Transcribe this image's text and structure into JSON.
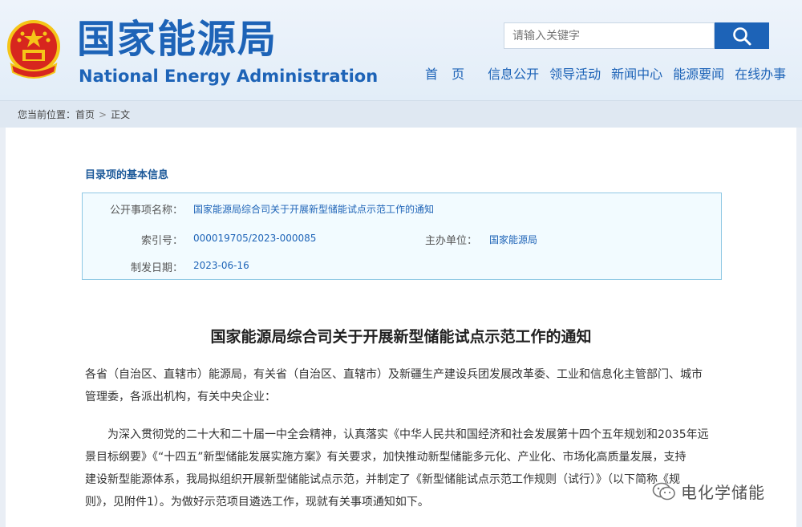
{
  "header": {
    "logo_cn": "国家能源局",
    "logo_en": "National Energy Administration",
    "search_placeholder": "请输入关键字",
    "nav": [
      "首 页",
      "信息公开",
      "领导活动",
      "新闻中心",
      "能源要闻",
      "在线办事"
    ]
  },
  "breadcrumb": {
    "label": "您当前位置：",
    "items": [
      "首页",
      "正文"
    ]
  },
  "info": {
    "section_title": "目录项的基本信息",
    "name_label": "公开事项名称：",
    "name_value": "国家能源局综合司关于开展新型储能试点示范工作的通知",
    "index_label": "索引号：",
    "index_value": "000019705/2023-000085",
    "org_label": "主办单位：",
    "org_value": "国家能源局",
    "date_label": "制发日期：",
    "date_value": "2023-06-16"
  },
  "article": {
    "title": "国家能源局综合司关于开展新型储能试点示范工作的通知",
    "para1_line1": "各省（自治区、直辖市）能源局，有关省（自治区、直辖市）及新疆生产建设兵团发展改革委、工业和信息化主管部门、城市",
    "para1_line2": "管理委，各派出机构，有关中央企业：",
    "para2_line1": "为深入贯彻党的二十大和二十届一中全会精神，认真落实《中华人民共和国经济和社会发展第十四个五年规划和2035年远",
    "para2_line2": "景目标纲要》《“十四五”新型储能发展实施方案》有关要求，加快推动新型储能多元化、产业化、市场化高质量发展，支持",
    "para2_line3": "建设新型能源体系，我局拟组织开展新型储能试点示范，并制定了《新型储能试点示范工作规则（试行）》（以下简称《规",
    "para2_line4": "则》，见附件1）。为做好示范项目遴选工作，现就有关事项通知如下。"
  },
  "watermark": {
    "text": "电化学储能",
    "icon": "wechat-icon"
  },
  "colors": {
    "brand_blue": "#1d63b7",
    "emblem_red": "#d7261e",
    "emblem_gold": "#f5c518"
  }
}
